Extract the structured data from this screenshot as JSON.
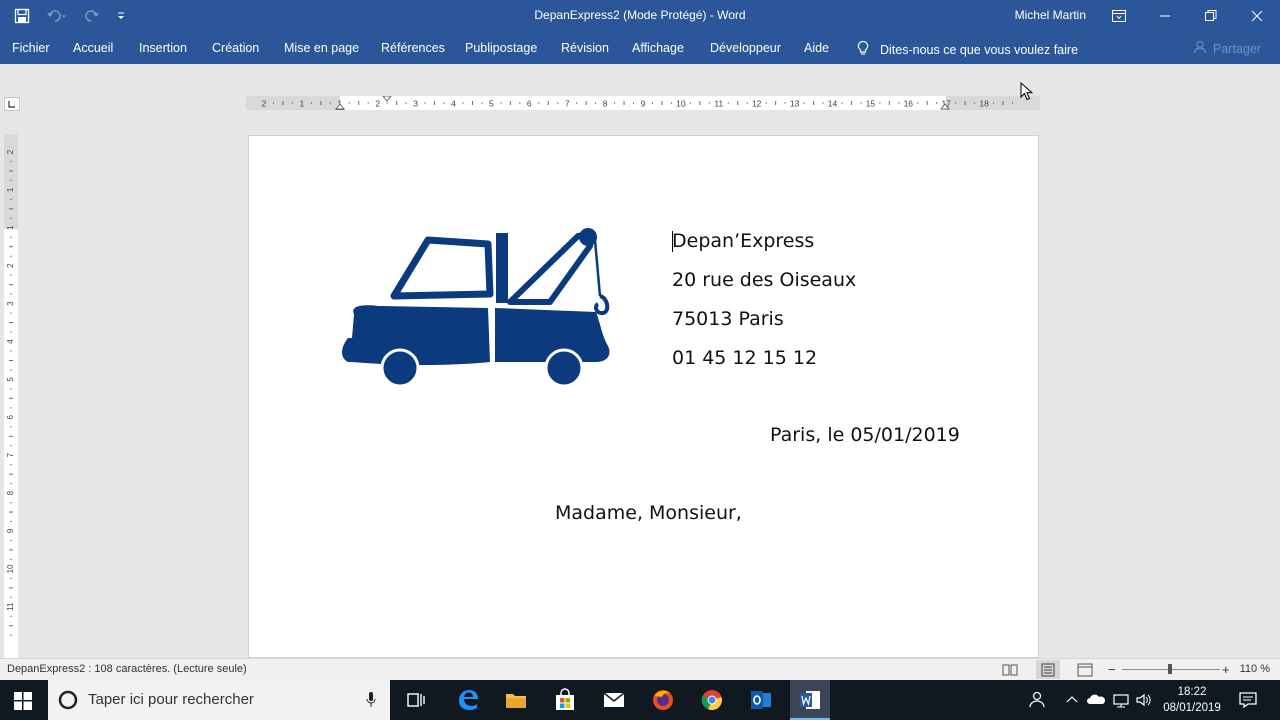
{
  "window": {
    "title": "DepanExpress2 (Mode Protégé)  -  Word",
    "user": "Michel Martin"
  },
  "ribbon": {
    "tabs": [
      "Fichier",
      "Accueil",
      "Insertion",
      "Création",
      "Mise en page",
      "Références",
      "Publipostage",
      "Révision",
      "Affichage",
      "Développeur",
      "Aide"
    ],
    "tell_me": "Dites-nous ce que vous voulez faire",
    "share": "Partager"
  },
  "ruler": {
    "h_labels": [
      "2",
      "1",
      "1",
      "2",
      "3",
      "4",
      "5",
      "6",
      "7",
      "8",
      "9",
      "10",
      "11",
      "12",
      "13",
      "14",
      "15",
      "16",
      "17",
      "18"
    ],
    "v_labels": [
      "2",
      "1",
      "1",
      "2",
      "3",
      "4",
      "5",
      "6",
      "7",
      "8",
      "9",
      "10",
      "11"
    ]
  },
  "document": {
    "company": "Depan’Express",
    "street": "20 rue des Oiseaux",
    "city": "75013 Paris",
    "phone": "01 45 12 15 12",
    "date_line": "Paris, le 05/01/2019",
    "salutation": "Madame, Monsieur,",
    "logo_color": "#0b3a7e"
  },
  "status": {
    "info": "DepanExpress2 : 108 caractères. (Lecture seule)",
    "zoom": "110 %"
  },
  "taskbar": {
    "search_placeholder": "Taper ici pour rechercher",
    "time": "18:22",
    "date": "08/01/2019"
  },
  "colors": {
    "word_blue": "#2b579a",
    "taskbar": "#101820"
  }
}
